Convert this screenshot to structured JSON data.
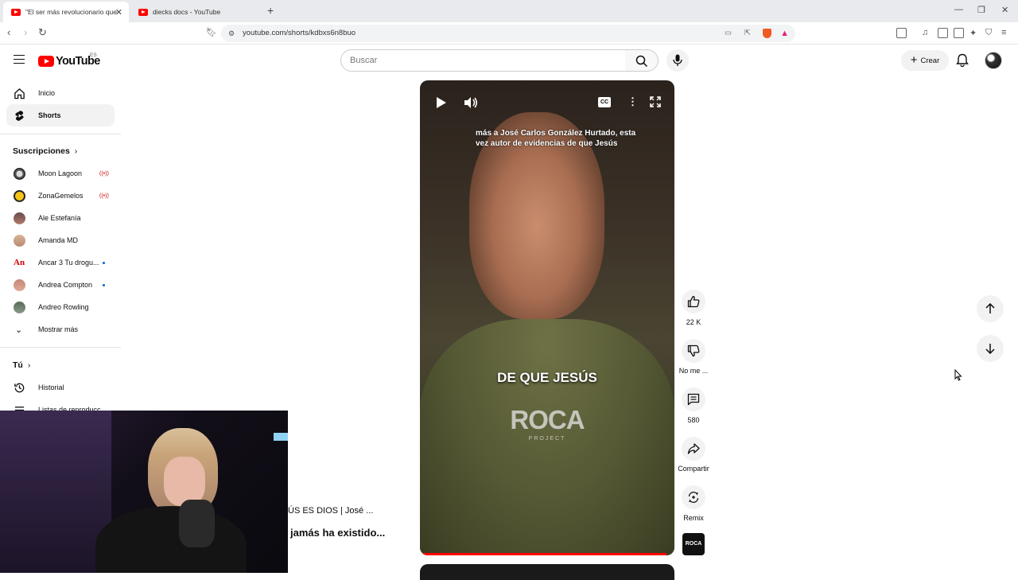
{
  "browser": {
    "tabs": [
      {
        "title": "\"El ser más revolucionario que ja",
        "active": true
      },
      {
        "title": "diecks docs - YouTube",
        "active": false
      }
    ],
    "new_tab": "+",
    "url": "youtube.com/shorts/kdbxs6n8buo"
  },
  "header": {
    "logo_text": "YouTube",
    "country_code": "ES",
    "search_placeholder": "Buscar",
    "create_label": "Crear"
  },
  "sidebar": {
    "main": [
      {
        "label": "Inicio",
        "icon": "home-icon"
      },
      {
        "label": "Shorts",
        "icon": "shorts-icon",
        "active": true
      }
    ],
    "subscriptions_title": "Suscripciones",
    "subscriptions": [
      {
        "label": "Moon Lagoon",
        "live": true
      },
      {
        "label": "ZonaGemelos",
        "live": true
      },
      {
        "label": "Ale Estefanía"
      },
      {
        "label": "Amanda MD"
      },
      {
        "label": "Ancar 3 Tu drogu...",
        "new": true
      },
      {
        "label": "Andrea Compton",
        "new": true
      },
      {
        "label": "Andreo Rowling"
      }
    ],
    "show_more": "Mostrar más",
    "you_title": "Tú",
    "you_items": [
      {
        "label": "Historial"
      },
      {
        "label": "Listas de reproducc..."
      }
    ]
  },
  "short": {
    "subtitle": "más a José Carlos González Hurtado, esta vez autor de evidencias de que Jesús",
    "overlay_text": "DE QUE JESÚS",
    "watermark": "ROCA",
    "watermark_sub": "PROJECT",
    "progress": 0.97,
    "caption_line1": "ÚS ES DIOS | José ...",
    "caption_line2": "jamás ha existido...",
    "cc_label": "CC"
  },
  "actions": {
    "likes": "22 K",
    "dislike_label": "No me ...",
    "comments": "580",
    "share_label": "Compartir",
    "remix_label": "Remix",
    "channel_avatar": "ROCA"
  },
  "colors": {
    "brand_red": "#ff0000",
    "live_red": "#cc0000",
    "new_dot": "#065fd4"
  }
}
